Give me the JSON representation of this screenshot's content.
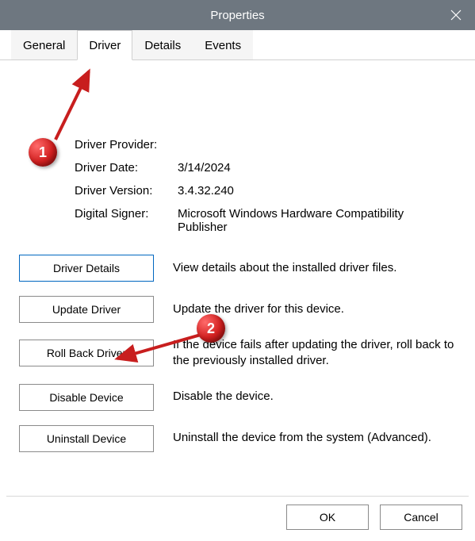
{
  "window": {
    "title": "Properties"
  },
  "tabs": {
    "general": "General",
    "driver": "Driver",
    "details": "Details",
    "events": "Events",
    "active": "driver"
  },
  "info": {
    "provider_label": "Driver Provider:",
    "provider_value": "",
    "date_label": "Driver Date:",
    "date_value": "3/14/2024",
    "version_label": "Driver Version:",
    "version_value": "3.4.32.240",
    "signer_label": "Digital Signer:",
    "signer_value": "Microsoft Windows Hardware Compatibility Publisher"
  },
  "actions": {
    "details": {
      "label": "Driver Details",
      "desc": "View details about the installed driver files."
    },
    "update": {
      "label": "Update Driver",
      "desc": "Update the driver for this device."
    },
    "rollback": {
      "label": "Roll Back Driver",
      "desc": "If the device fails after updating the driver, roll back to the previously installed driver."
    },
    "disable": {
      "label": "Disable Device",
      "desc": "Disable the device."
    },
    "uninstall": {
      "label": "Uninstall Device",
      "desc": "Uninstall the device from the system (Advanced)."
    }
  },
  "footer": {
    "ok": "OK",
    "cancel": "Cancel"
  },
  "annotations": {
    "one": "1",
    "two": "2"
  }
}
